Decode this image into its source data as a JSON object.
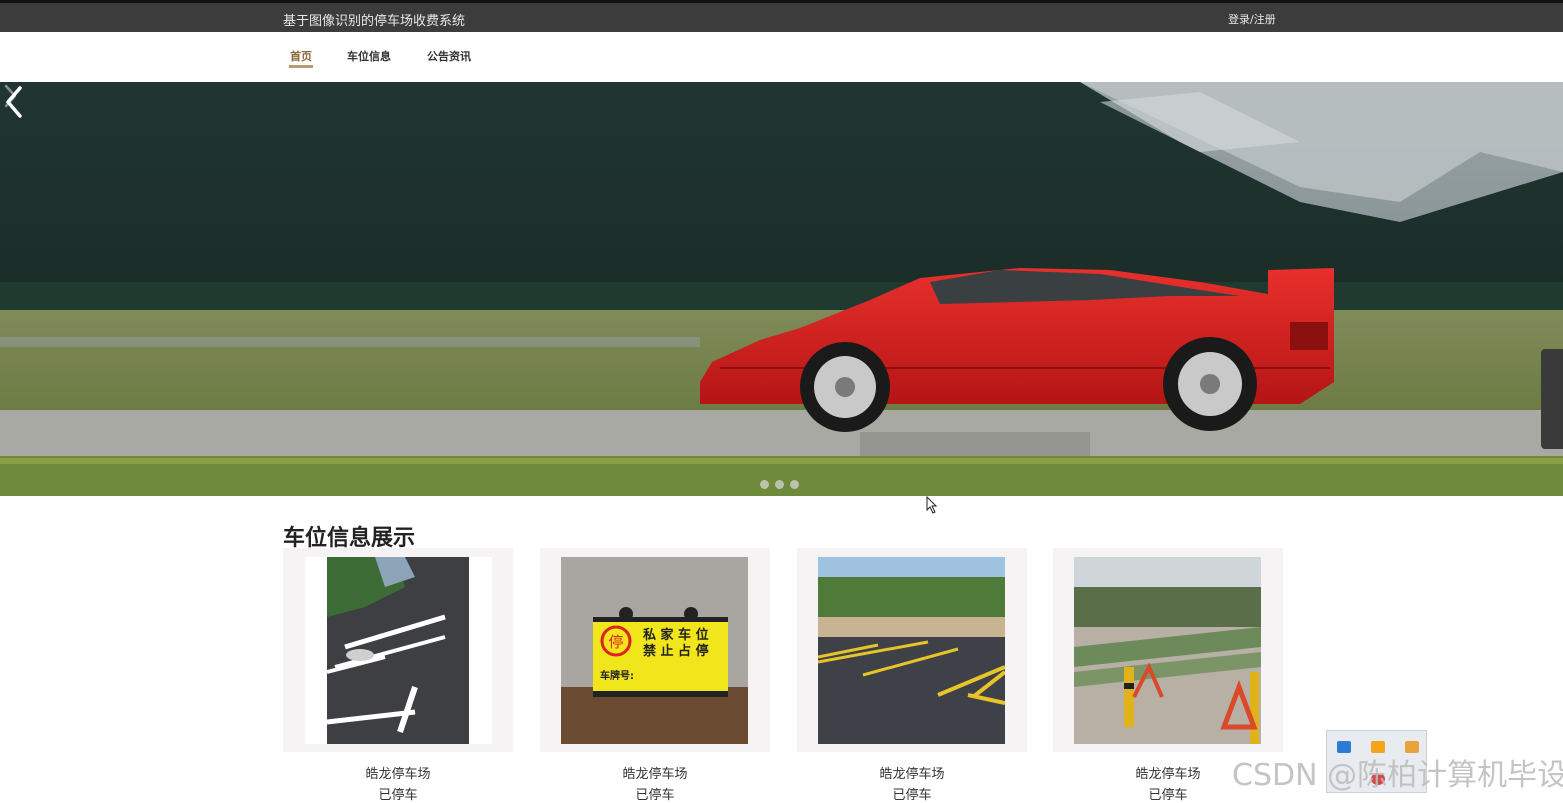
{
  "header": {
    "site_title": "基于图像识别的停车场收费系统",
    "login_label": "登录/注册"
  },
  "nav": {
    "items": [
      "首页",
      "车位信息",
      "公告资讯"
    ],
    "active": "首页"
  },
  "banner": {
    "slide_count": 3,
    "active_slide": 1
  },
  "section": {
    "title": "车位信息展示"
  },
  "cards": [
    {
      "name": "皓龙停车场",
      "status": "已停车"
    },
    {
      "name": "皓龙停车场",
      "status": "已停车"
    },
    {
      "name": "皓龙停车场",
      "status": "已停车"
    },
    {
      "name": "皓龙停车场",
      "status": "已停车"
    }
  ],
  "sign_text": {
    "line1": "私 家 车 位",
    "line2": "禁 止 占 停",
    "plate_label": "车牌号:",
    "symbol": "停"
  },
  "watermark": "CSDN @陈柏计算机毕设",
  "colors": {
    "topbar": "#3c3c3c",
    "nav_active": "#8a6a3a",
    "car_red": "#d41d1d",
    "sign_yellow": "#f1e51b"
  }
}
